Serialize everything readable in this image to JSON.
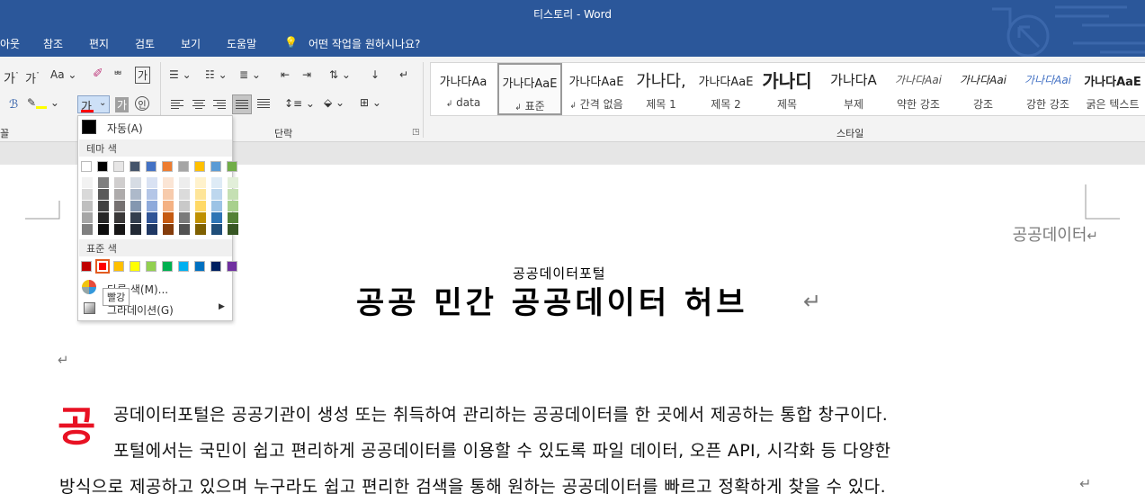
{
  "window": {
    "title": "티스토리  -  Word"
  },
  "tabs": [
    "아웃",
    "참조",
    "편지",
    "검토",
    "보기",
    "도움말"
  ],
  "tell_me": "어떤 작업을 원하시나요?",
  "ribbon": {
    "groups": {
      "font_partial": "꼴",
      "paragraph": "단락",
      "styles": "스타일"
    },
    "font_button_letter": "가",
    "font_size_aa": "Aa",
    "char_icon1": "가",
    "char_icon2": "가"
  },
  "styles": [
    {
      "preview": "가나다Aa",
      "name": "data"
    },
    {
      "preview": "가나다AaE",
      "name": "표준"
    },
    {
      "preview": "가나다AaE",
      "name": "간격 없음"
    },
    {
      "preview": "가나다,",
      "name": "제목 1"
    },
    {
      "preview": "가나다AaE",
      "name": "제목 2"
    },
    {
      "preview": "가나디",
      "name": "제목"
    },
    {
      "preview": "가나다A",
      "name": "부제"
    },
    {
      "preview": "가나다Aai",
      "name": "약한 강조"
    },
    {
      "preview": "가나다Aai",
      "name": "강조"
    },
    {
      "preview": "가나다Aai",
      "name": "강한 강조"
    },
    {
      "preview": "가나다AaE",
      "name": "굵은 텍스트"
    }
  ],
  "document": {
    "header": "공공데이터",
    "ruby": "공공데이터포털",
    "title": "공공 민간 공공데이터 허브",
    "dropcap": "공",
    "lines": [
      "공데이터포털은 공공기관이 생성 또는 취득하여 관리하는 공공데이터를 한 곳에서 제공하는 통합 창구이다.",
      "포털에서는 국민이 쉽고 편리하게 공공데이터를 이용할 수 있도록 파일 데이터, 오픈 API, 시각화 등 다양한",
      "방식으로 제공하고 있으며 누구라도 쉽고 편리한 검색을 통해 원하는 공공데이터를 빠르고 정확하게 찾을 수 있다."
    ],
    "para_mark": "↵"
  },
  "color_menu": {
    "auto": "자동(A)",
    "theme_header": "테마 색",
    "standard_header": "표준 색",
    "more_colors": "다른 색(M)...",
    "gradient": "그라데이션(G)",
    "tooltip": "빨강",
    "theme_top": [
      "#ffffff",
      "#000000",
      "#e7e6e6",
      "#44546a",
      "#4472c4",
      "#ed7d31",
      "#a5a5a5",
      "#ffc000",
      "#5b9bd5",
      "#70ad47"
    ],
    "theme_shades": [
      [
        "#f2f2f2",
        "#d9d9d9",
        "#bfbfbf",
        "#a6a6a6",
        "#808080"
      ],
      [
        "#7f7f7f",
        "#595959",
        "#404040",
        "#262626",
        "#0d0d0d"
      ],
      [
        "#d0cece",
        "#aeabab",
        "#757171",
        "#3a3838",
        "#171616"
      ],
      [
        "#d6dce4",
        "#adb9ca",
        "#8497b0",
        "#333f4f",
        "#222a35"
      ],
      [
        "#d9e2f3",
        "#b4c6e7",
        "#8eaadb",
        "#2f5496",
        "#1f3864"
      ],
      [
        "#fbe5d5",
        "#f7cbac",
        "#f4b183",
        "#c55a11",
        "#843c0b"
      ],
      [
        "#ededed",
        "#dbdbdb",
        "#c9c9c9",
        "#7b7b7b",
        "#525252"
      ],
      [
        "#fff2cc",
        "#fee599",
        "#ffd966",
        "#bf9000",
        "#7f6000"
      ],
      [
        "#deebf6",
        "#bdd7ee",
        "#9cc3e5",
        "#2e75b5",
        "#1f4e79"
      ],
      [
        "#e2efd9",
        "#c5e0b3",
        "#a8d08d",
        "#538135",
        "#375623"
      ]
    ],
    "standard": [
      "#c00000",
      "#ff0000",
      "#ffc000",
      "#ffff00",
      "#92d050",
      "#00b050",
      "#00b0f0",
      "#0070c0",
      "#002060",
      "#7030a0"
    ],
    "selected_standard_index": 1
  }
}
